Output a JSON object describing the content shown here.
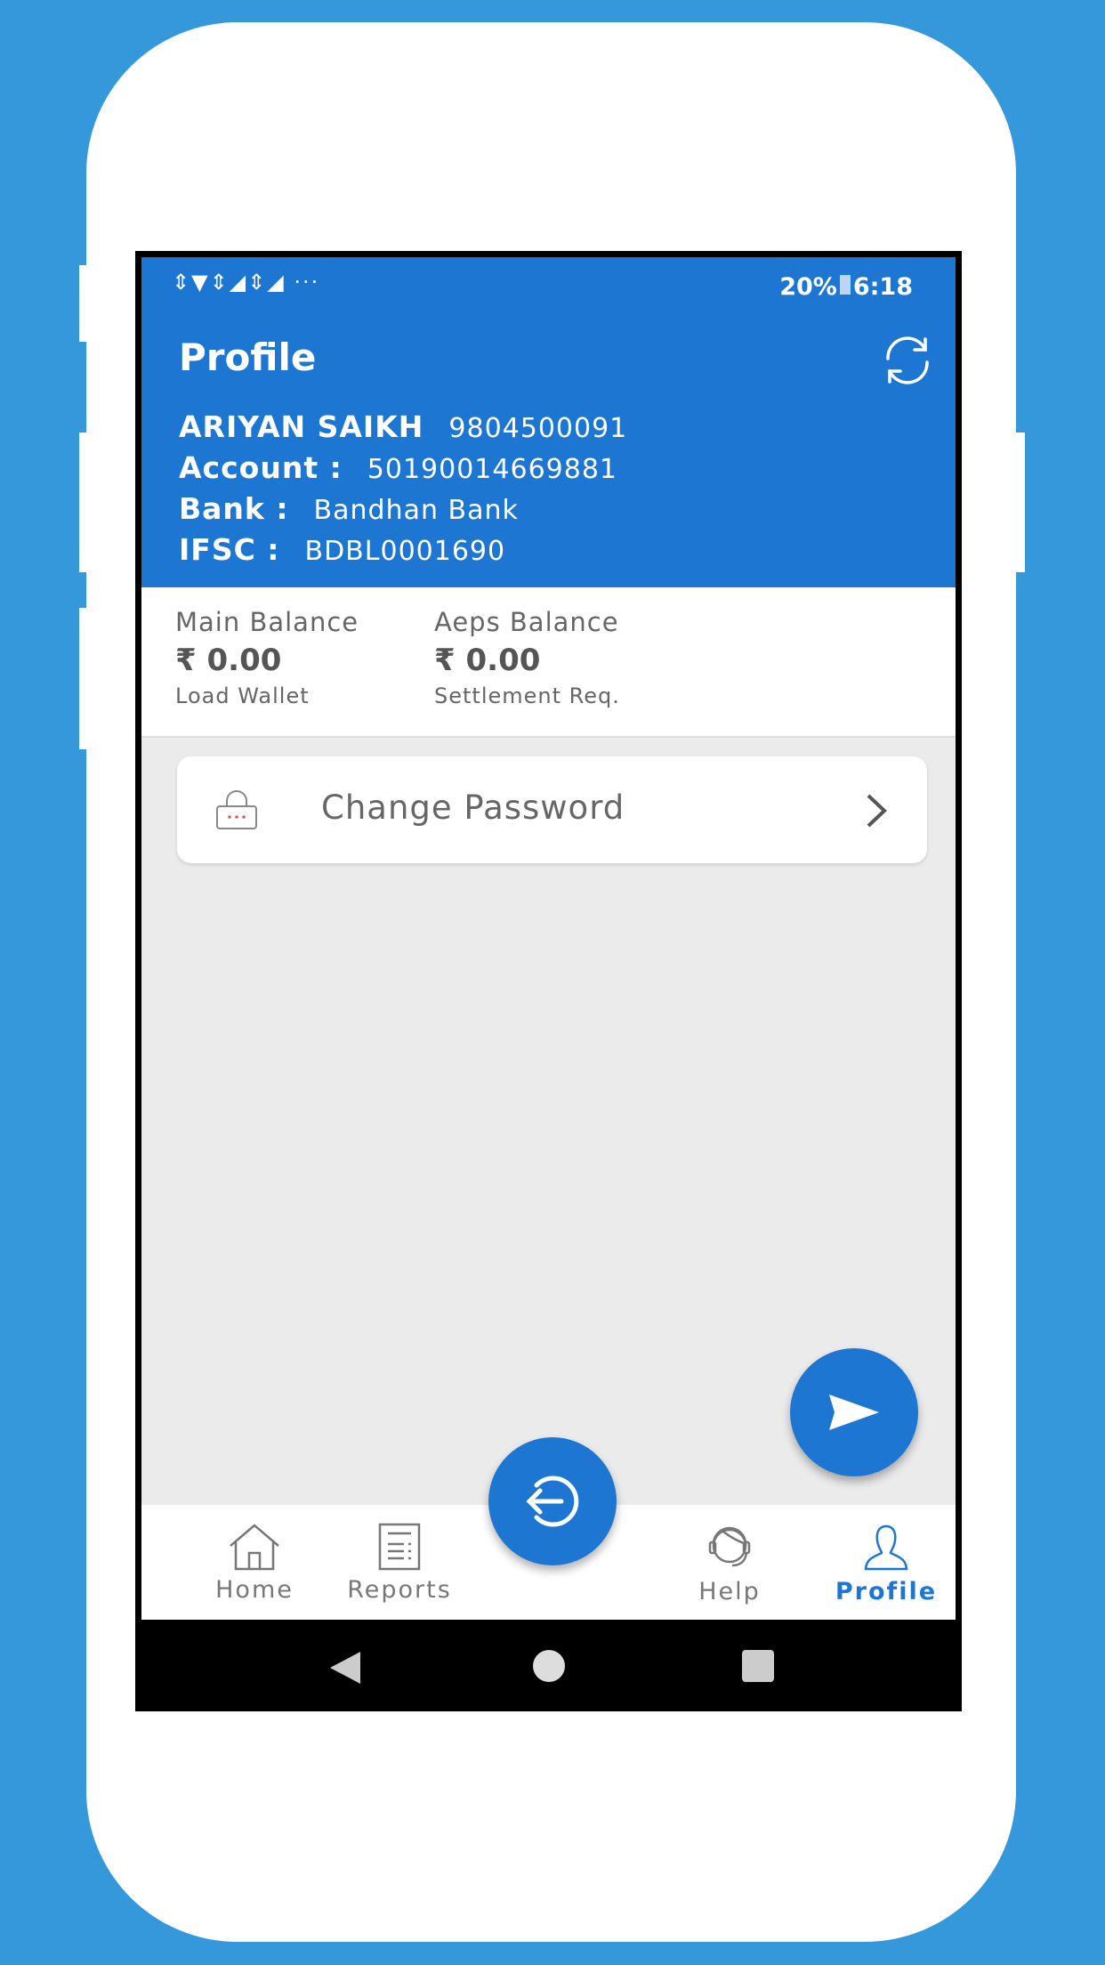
{
  "status_bar": {
    "icons": "⇕▼⇕◢⇕◢ ···",
    "battery": "20%",
    "time": "6:18"
  },
  "toolbar": {
    "title": "Profile",
    "refresh_icon": "refresh-icon"
  },
  "user": {
    "name": "ARIYAN SAIKH",
    "phone": "9804500091",
    "account_label": "Account :",
    "account": "50190014669881",
    "bank_label": "Bank :",
    "bank": "Bandhan Bank",
    "ifsc_label": "IFSC :",
    "ifsc": "BDBL0001690"
  },
  "balances": [
    {
      "label": "Main Balance",
      "amount": "₹ 0.00",
      "action": "Load Wallet"
    },
    {
      "label": "Aeps Balance",
      "amount": "₹ 0.00",
      "action": "Settlement Req."
    }
  ],
  "menu": [
    {
      "label": "Change Password",
      "icon": "lock-icon"
    }
  ],
  "bottom_nav": {
    "items": [
      {
        "label": "Home",
        "icon": "home-icon"
      },
      {
        "label": "Reports",
        "icon": "reports-icon"
      },
      {
        "label": "Help",
        "icon": "support-icon"
      },
      {
        "label": "Profile",
        "icon": "user-icon",
        "active": true
      }
    ]
  },
  "colors": {
    "primary": "#1c76d2",
    "background": "#3598db",
    "content_bg": "#ebebeb"
  }
}
